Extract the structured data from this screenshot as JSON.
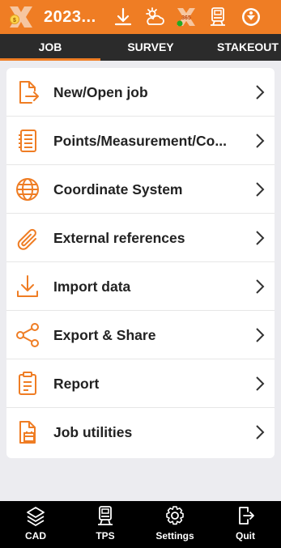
{
  "appbar": {
    "title": "2023...",
    "status_icons": [
      "download-icon",
      "weather-icon",
      "gnss-365-icon",
      "total-station-icon",
      "connection-icon"
    ],
    "gnss_badge": "365"
  },
  "tabs": [
    {
      "label": "JOB",
      "active": true
    },
    {
      "label": "SURVEY",
      "active": false
    },
    {
      "label": "STAKEOUT",
      "active": false
    }
  ],
  "menu": [
    {
      "label": "New/Open job",
      "icon": "file-open-icon"
    },
    {
      "label": "Points/Measurement/Co...",
      "icon": "points-list-icon"
    },
    {
      "label": "Coordinate System",
      "icon": "globe-icon"
    },
    {
      "label": "External references",
      "icon": "paperclip-icon"
    },
    {
      "label": "Import data",
      "icon": "import-icon"
    },
    {
      "label": "Export & Share",
      "icon": "share-icon"
    },
    {
      "label": "Report",
      "icon": "report-icon"
    },
    {
      "label": "Job utilities",
      "icon": "job-utilities-icon"
    }
  ],
  "bottom_nav": [
    {
      "label": "CAD",
      "icon": "layers-icon"
    },
    {
      "label": "TPS",
      "icon": "total-station-icon"
    },
    {
      "label": "Settings",
      "icon": "gear-icon"
    },
    {
      "label": "Quit",
      "icon": "exit-icon"
    }
  ],
  "colors": {
    "accent": "#ef7d24",
    "tab_bg": "#2b2b2b",
    "bottom_bg": "#000000",
    "background": "#ececf0"
  }
}
